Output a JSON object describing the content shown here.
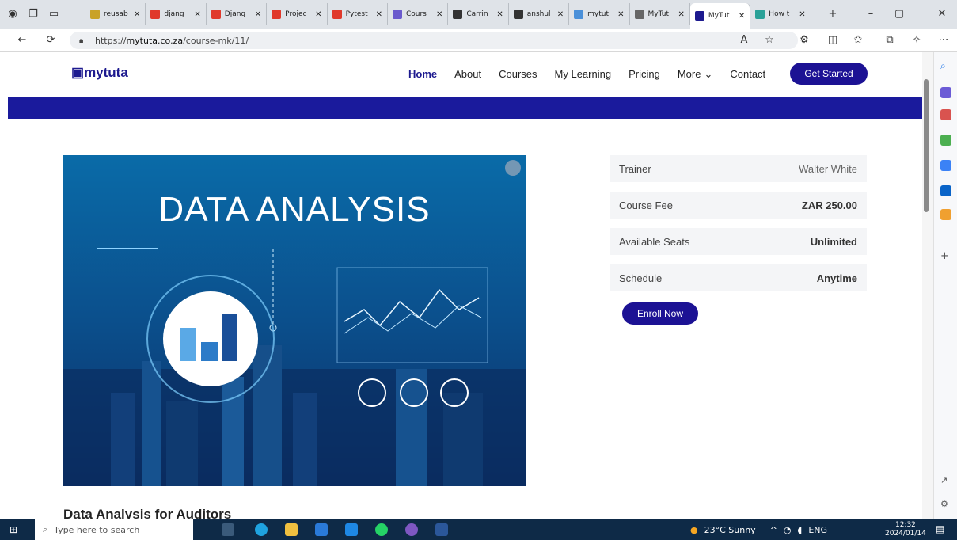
{
  "browser": {
    "tabs": [
      {
        "label": "reusab",
        "color": "#c9a227"
      },
      {
        "label": "djang",
        "color": "#e0392b"
      },
      {
        "label": "Djang",
        "color": "#e0392b"
      },
      {
        "label": "Projec",
        "color": "#e0392b"
      },
      {
        "label": "Pytest",
        "color": "#e0392b"
      },
      {
        "label": "Cours",
        "color": "#6a5acd"
      },
      {
        "label": "Carrin",
        "color": "#333"
      },
      {
        "label": "anshul",
        "color": "#333"
      },
      {
        "label": "mytut",
        "color": "#4a90d9"
      },
      {
        "label": "MyTut",
        "color": "#666"
      },
      {
        "label": "MyTut",
        "color": "#1d1a8f"
      },
      {
        "label": "How t",
        "color": "#2aa198"
      }
    ],
    "url_prefix": "https://",
    "url_domain": "mytuta.co.za",
    "url_path": "/course-mk/11/"
  },
  "site": {
    "logo": "mytuta",
    "nav": [
      "Home",
      "About",
      "Courses",
      "My Learning",
      "Pricing",
      "More",
      "Contact"
    ],
    "cta": "Get Started"
  },
  "hero": {
    "title": "DATA ANALYSIS"
  },
  "details": [
    {
      "key": "Trainer",
      "value": "Walter White"
    },
    {
      "key": "Course Fee",
      "value": "ZAR 250.00"
    },
    {
      "key": "Available Seats",
      "value": "Unlimited"
    },
    {
      "key": "Schedule",
      "value": "Anytime"
    }
  ],
  "enroll": "Enroll Now",
  "course_title": "Data Analysis for Auditors",
  "taskbar": {
    "search_placeholder": "Type here to search",
    "weather": "23°C  Sunny",
    "lang": "ENG",
    "time": "12:32",
    "date": "2024/01/14"
  }
}
